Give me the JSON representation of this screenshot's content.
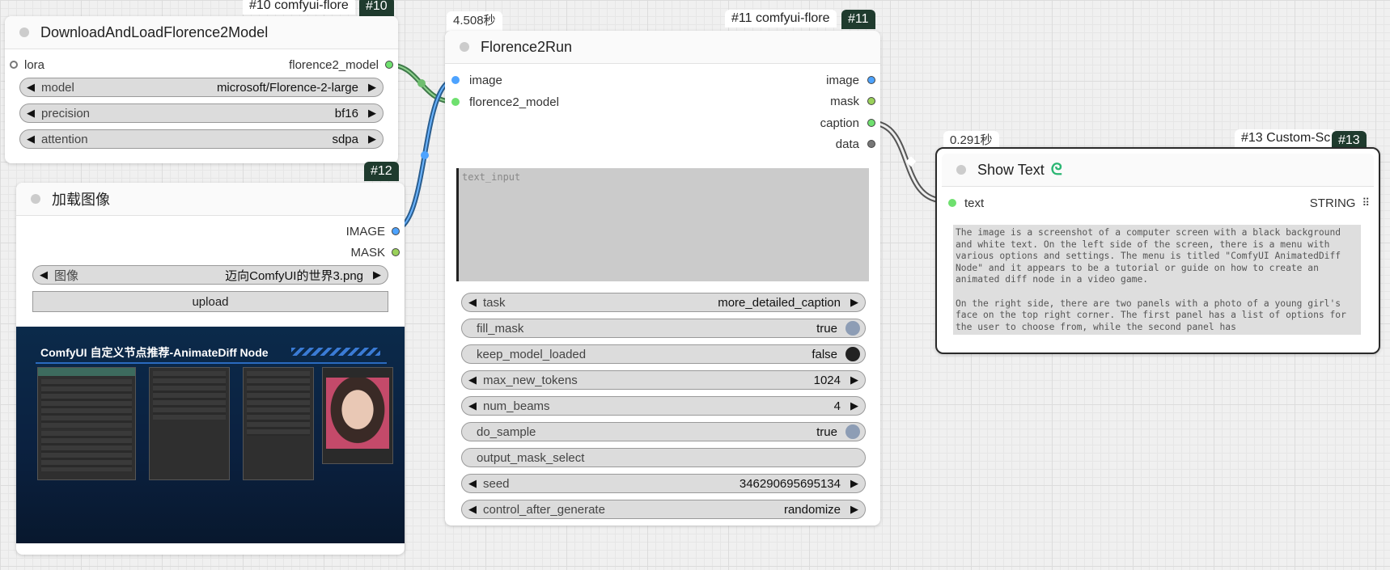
{
  "nodes": {
    "download": {
      "title": "DownloadAndLoadFlorence2Model",
      "tag": "#10 comfyui-flore",
      "badge": "#10",
      "input_lora": "lora",
      "output_label": "florence2_model",
      "widgets": [
        {
          "label": "model",
          "value": "microsoft/Florence-2-large"
        },
        {
          "label": "precision",
          "value": "bf16"
        },
        {
          "label": "attention",
          "value": "sdpa"
        }
      ]
    },
    "load_image": {
      "title": "加载图像",
      "badge": "#12",
      "outputs": [
        "IMAGE",
        "MASK"
      ],
      "widget": {
        "label": "图像",
        "value": "迈向ComfyUI的世界3.png"
      },
      "upload_label": "upload",
      "preview": {
        "title": "ComfyUI 自定义节点推荐-AnimateDiff Node"
      }
    },
    "florence_run": {
      "timer": "4.508秒",
      "tag": "#11 comfyui-flore",
      "badge": "#11",
      "title": "Florence2Run",
      "inputs": [
        "image",
        "florence2_model"
      ],
      "outputs": [
        "image",
        "mask",
        "caption",
        "data"
      ],
      "text_input_placeholder": "text_input",
      "widgets": [
        {
          "label": "task",
          "value": "more_detailed_caption"
        },
        {
          "label": "fill_mask",
          "value": "true"
        },
        {
          "label": "keep_model_loaded",
          "value": "false"
        },
        {
          "label": "max_new_tokens",
          "value": "1024"
        },
        {
          "label": "num_beams",
          "value": "4"
        },
        {
          "label": "do_sample",
          "value": "true"
        },
        {
          "label": "output_mask_select",
          "value": ""
        },
        {
          "label": "seed",
          "value": "346290695695134"
        },
        {
          "label": "control_after_generate",
          "value": "randomize"
        }
      ]
    },
    "show_text": {
      "timer": "0.291秒",
      "tag": "#13 Custom-Sc",
      "badge": "#13",
      "title": "Show Text",
      "input_label": "text",
      "type_label": "STRING",
      "text": "The image is a screenshot of a computer screen with a black background and white text. On the left side of the screen, there is a menu with various options and settings. The menu is titled \"ComfyUI AnimatedDiff Node\" and it appears to be a tutorial or guide on how to create an animated diff node in a video game.\n\nOn the right side, there are two panels with a photo of a young girl's face on the top right corner. The first panel has a list of options for the user to choose from, while the second panel has"
    }
  },
  "colors": {
    "badge_bg": "#1f3b2e",
    "port_image": "#4da3ff",
    "port_model": "#6fe06f",
    "port_mask": "#9ad15a",
    "port_caption": "#6fe06f",
    "port_data": "#777777",
    "link_model": "#3f7a4a",
    "link_image": "#4a8fd8",
    "link_caption": "#666666",
    "toggle_on": "#8d9db5",
    "toggle_off": "#222222",
    "logo_accent": "#2bb673"
  }
}
